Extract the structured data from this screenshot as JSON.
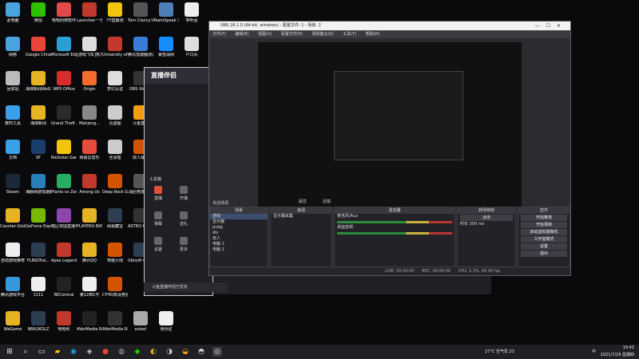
{
  "desktop": {
    "icons": [
      {
        "label": "此电脑",
        "col": 0,
        "row": 0,
        "color": "#4aa3df"
      },
      {
        "label": "微信",
        "col": 1,
        "row": 0,
        "color": "#2dc100"
      },
      {
        "label": "哈哈利用软件",
        "col": 2,
        "row": 0,
        "color": "#e04a4a"
      },
      {
        "label": "Launcher-一快速方式",
        "col": 3,
        "row": 0,
        "color": "#c0392b"
      },
      {
        "label": "YY直播测",
        "col": 4,
        "row": 0,
        "color": "#f1c40f"
      },
      {
        "label": "Tom Clancy's R...",
        "col": 5,
        "row": 0,
        "color": "#555"
      },
      {
        "label": "TeamSpeak 3",
        "col": 6,
        "row": 0,
        "color": "#4d7fb8"
      },
      {
        "label": "亭听话",
        "col": 7,
        "row": 0,
        "color": "#eee"
      },
      {
        "label": "网络",
        "col": 0,
        "row": 1,
        "color": "#4aa3df"
      },
      {
        "label": "Google Chrome",
        "col": 1,
        "row": 1,
        "color": "#e8443a"
      },
      {
        "label": "Microsoft Edge",
        "col": 2,
        "row": 1,
        "color": "#2a9fd6"
      },
      {
        "label": "[游戏飞车]热力游戏",
        "col": 3,
        "row": 1,
        "color": "#ddd"
      },
      {
        "label": "University of Manitoba",
        "col": 4,
        "row": 1,
        "color": "#c0392b"
      },
      {
        "label": "腾讯加速器测试",
        "col": 5,
        "row": 1,
        "color": "#3a7bd5"
      },
      {
        "label": "暴雪战网",
        "col": 6,
        "row": 1,
        "color": "#148eff"
      },
      {
        "label": "户口页",
        "col": 7,
        "row": 1,
        "color": "#ddd"
      },
      {
        "label": "回收站",
        "col": 0,
        "row": 2,
        "color": "#bbb"
      },
      {
        "label": "湘潭新闻WeGame",
        "col": 1,
        "row": 2,
        "color": "#e6b422"
      },
      {
        "label": "WPS Office",
        "col": 2,
        "row": 2,
        "color": "#d62c2c"
      },
      {
        "label": "Origin",
        "col": 3,
        "row": 2,
        "color": "#f56c2d"
      },
      {
        "label": "梦幻认证",
        "col": 4,
        "row": 2,
        "color": "#ddd"
      },
      {
        "label": "OBS Studio",
        "col": 5,
        "row": 2,
        "color": "#333"
      },
      {
        "label": "麦时工具",
        "col": 0,
        "row": 3,
        "color": "#3aa0e8"
      },
      {
        "label": "湘潭新闻",
        "col": 1,
        "row": 3,
        "color": "#e6b422"
      },
      {
        "label": "Grand Theft Auto V",
        "col": 2,
        "row": 3,
        "color": "#2b2b2b"
      },
      {
        "label": "Mahjong...",
        "col": 3,
        "row": 3,
        "color": "#888"
      },
      {
        "label": "合虚图",
        "col": 4,
        "row": 3,
        "color": "#ccc"
      },
      {
        "label": "斗鱼直播",
        "col": 5,
        "row": 3,
        "color": "#f39c12"
      },
      {
        "label": "文档",
        "col": 0,
        "row": 4,
        "color": "#3aa0e8"
      },
      {
        "label": "SF",
        "col": 1,
        "row": 4,
        "color": "#1b3d6e"
      },
      {
        "label": "Rockstar Games...",
        "col": 2,
        "row": 4,
        "color": "#f1c40f"
      },
      {
        "label": "网易云音乐",
        "col": 3,
        "row": 4,
        "color": "#e74c3c"
      },
      {
        "label": "全清理",
        "col": 4,
        "row": 4,
        "color": "#ccc"
      },
      {
        "label": "双人成行",
        "col": 5,
        "row": 4,
        "color": "#d35400"
      },
      {
        "label": "Steam",
        "col": 0,
        "row": 5,
        "color": "#1b2838"
      },
      {
        "label": "海豚网游加速器",
        "col": 1,
        "row": 5,
        "color": "#2980b9"
      },
      {
        "label": "Plants vs Zombies G...",
        "col": 2,
        "row": 5,
        "color": "#27ae60"
      },
      {
        "label": "Among Us",
        "col": 3,
        "row": 5,
        "color": "#c0392b"
      },
      {
        "label": "Deep Rock Galactic",
        "col": 4,
        "row": 5,
        "color": "#d35400"
      },
      {
        "label": "战后竞技巨星",
        "col": 5,
        "row": 5,
        "color": "#555"
      },
      {
        "label": "Counter-Global Off...",
        "col": 0,
        "row": 6,
        "color": "#e6b422"
      },
      {
        "label": "GeForce Experience",
        "col": 1,
        "row": 6,
        "color": "#76b900"
      },
      {
        "label": "暗区突围直播专用",
        "col": 2,
        "row": 6,
        "color": "#8e44ad"
      },
      {
        "label": "PLAYERU BATTLEGR...",
        "col": 3,
        "row": 6,
        "color": "#e6b422"
      },
      {
        "label": "网易藏宝",
        "col": 4,
        "row": 6,
        "color": "#2c3e50"
      },
      {
        "label": "ASTRO Command",
        "col": 5,
        "row": 6,
        "color": "#333"
      },
      {
        "label": "自动游戏推荐",
        "col": 0,
        "row": 7,
        "color": "#eee"
      },
      {
        "label": "FLINGTrai...",
        "col": 1,
        "row": 7,
        "color": "#2c3e50"
      },
      {
        "label": "Apex Legends",
        "col": 2,
        "row": 7,
        "color": "#c0392b"
      },
      {
        "label": "腾讯QQ",
        "col": 3,
        "row": 7,
        "color": "#e6b422"
      },
      {
        "label": "穿越火线",
        "col": 4,
        "row": 7,
        "color": "#d35400"
      },
      {
        "label": "Ubisoft Connect",
        "col": 5,
        "row": 7,
        "color": "#2c3e50"
      },
      {
        "label": "腾讯游戏平台",
        "col": 0,
        "row": 8,
        "color": "#3498db"
      },
      {
        "label": "1111",
        "col": 1,
        "row": 8,
        "color": "#eee"
      },
      {
        "label": "RECentral",
        "col": 2,
        "row": 8,
        "color": "#222"
      },
      {
        "label": "第12档1号",
        "col": 3,
        "row": 8,
        "color": "#eee"
      },
      {
        "label": "CFHD高清竞技大区",
        "col": 4,
        "row": 8,
        "color": "#d35400"
      },
      {
        "label": "WeGame",
        "col": 0,
        "row": 9,
        "color": "#e6b422"
      },
      {
        "label": "NBA2KOLZ",
        "col": 1,
        "row": 9,
        "color": "#2c3e50"
      },
      {
        "label": "哈哈利",
        "col": 2,
        "row": 9,
        "color": "#c0392b"
      },
      {
        "label": "AVerMedia RECentral 4",
        "col": 3,
        "row": 9,
        "color": "#222"
      },
      {
        "label": "AVerMedia RECentral...",
        "col": 4,
        "row": 9,
        "color": "#333"
      },
      {
        "label": "ezlest",
        "col": 5,
        "row": 9,
        "color": "#aaa"
      },
      {
        "label": "身份证",
        "col": 6,
        "row": 9,
        "color": "#eee"
      }
    ]
  },
  "obs": {
    "title": "OBS 26.1.0 (64-bit, windows) - 配置文件: 1 - 场景: 2",
    "menu": [
      "文件(F)",
      "编辑(E)",
      "视图(V)",
      "配置文件(P)",
      "场景集合(S)",
      "工具(T)",
      "帮助(H)"
    ],
    "scene_label": "未选择源",
    "properties_btn": "属性",
    "filters_btn": "滤镜",
    "scenes_header": "场景",
    "scenes": [
      "游戏",
      "显示器",
      "pubg",
      "dls",
      "双人",
      "电脑 1",
      "电脑 2"
    ],
    "sources_header": "来源",
    "sources": [
      "显示器采集"
    ],
    "mixer_header": "混音器",
    "mixer": [
      {
        "name": "麦克风/Aux",
        "db": "0.0 dB"
      },
      {
        "name": "桌面音频",
        "db": "0.0 dB"
      }
    ],
    "transitions_header": "转场特效",
    "transition_select": "淡出",
    "duration_label": "时长",
    "duration_value": "300 ms",
    "controls_header": "控件",
    "controls": [
      "开始推流",
      "开始录制",
      "启动虚拟摄像机",
      "工作室模式",
      "设置",
      "退出"
    ],
    "status": [
      "LIVE: 00:00:00",
      "REC: 00:00:00",
      "CPU: 1.3%, 60.00 fps"
    ]
  },
  "assistant": {
    "title": "直播伴侣",
    "menu_items": [
      "直播",
      "开播",
      "弹幕",
      "送礼",
      "设置",
      "更多"
    ],
    "tools_label": "工具箱",
    "chat_text": "斗鱼直播伴侣已优化"
  },
  "taskbar": {
    "weather": "27°C 空气优 23",
    "time": "19:42",
    "date": "2021/7/29 星期四",
    "lang": "中"
  }
}
